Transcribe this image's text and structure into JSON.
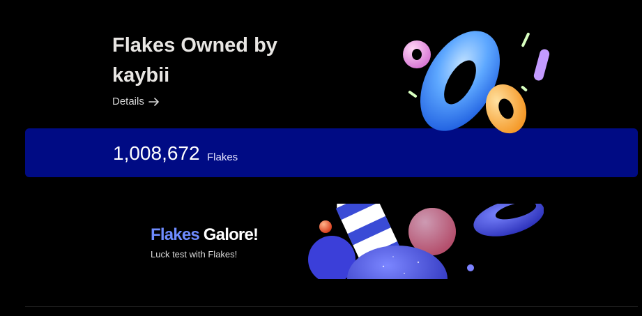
{
  "header": {
    "title": "Flakes Owned by kaybii",
    "details_label": "Details"
  },
  "flakes": {
    "count": "1,008,672",
    "unit": "Flakes"
  },
  "promo": {
    "title_accent": "Flakes",
    "title_rest": " Galore!",
    "subtitle": "Luck test with Flakes!"
  },
  "colors": {
    "background": "#000000",
    "bar": "#000b84",
    "accent": "#6f8cff"
  },
  "icons": {
    "details_arrow": "arrow-right-icon"
  }
}
